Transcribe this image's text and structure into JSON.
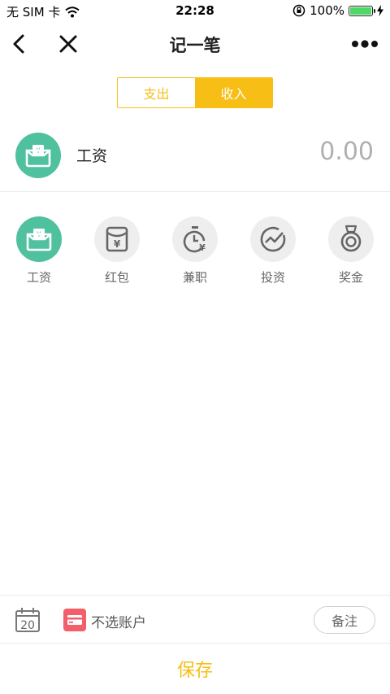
{
  "status_bar": {
    "carrier": "无 SIM 卡",
    "time": "22:28",
    "battery_percent": "100%"
  },
  "nav": {
    "title": "记一笔",
    "icons": [
      "back-icon",
      "close-icon",
      "more-icon"
    ]
  },
  "segment": {
    "options": [
      "支出",
      "收入"
    ],
    "selected": "收入"
  },
  "selected_category": {
    "label": "工资",
    "amount": "0.00"
  },
  "categories": [
    {
      "label": "工资",
      "icon": "wallet-icon",
      "active": true
    },
    {
      "label": "红包",
      "icon": "red-envelope-icon",
      "active": false
    },
    {
      "label": "兼职",
      "icon": "stopwatch-yen-icon",
      "active": false
    },
    {
      "label": "投资",
      "icon": "trend-icon",
      "active": false
    },
    {
      "label": "奖金",
      "icon": "medal-icon",
      "active": false
    }
  ],
  "bottom": {
    "date_day": "20",
    "account_label": "不选账户",
    "note_label": "备注",
    "save_label": "保存"
  },
  "colors": {
    "accent": "#f7be16",
    "green": "#4fc19f",
    "account_red": "#f25f6a",
    "amount_grey": "#b0b0b0"
  }
}
